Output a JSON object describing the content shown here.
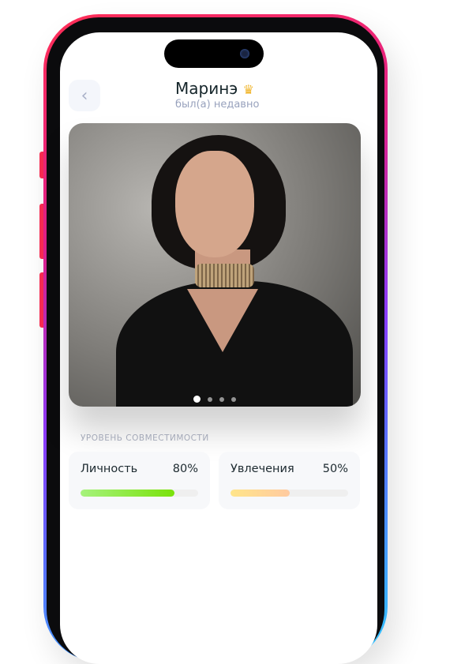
{
  "header": {
    "name": "Маринэ",
    "status": "был(а) недавно",
    "badge_icon": "crown-icon",
    "back_icon": "chevron-left-icon"
  },
  "photo": {
    "slide_count": 4,
    "active_slide": 1
  },
  "compatibility": {
    "title": "УРОВЕНЬ СОВМЕСТИМОСТИ",
    "items": [
      {
        "label": "Личность",
        "value_text": "80%",
        "value": 80,
        "colors": [
          "#a6f27c",
          "#7ae20a"
        ]
      },
      {
        "label": "Увлечения",
        "value_text": "50%",
        "value": 50,
        "colors": [
          "#ffe58a",
          "#ffcaa0"
        ]
      }
    ]
  }
}
